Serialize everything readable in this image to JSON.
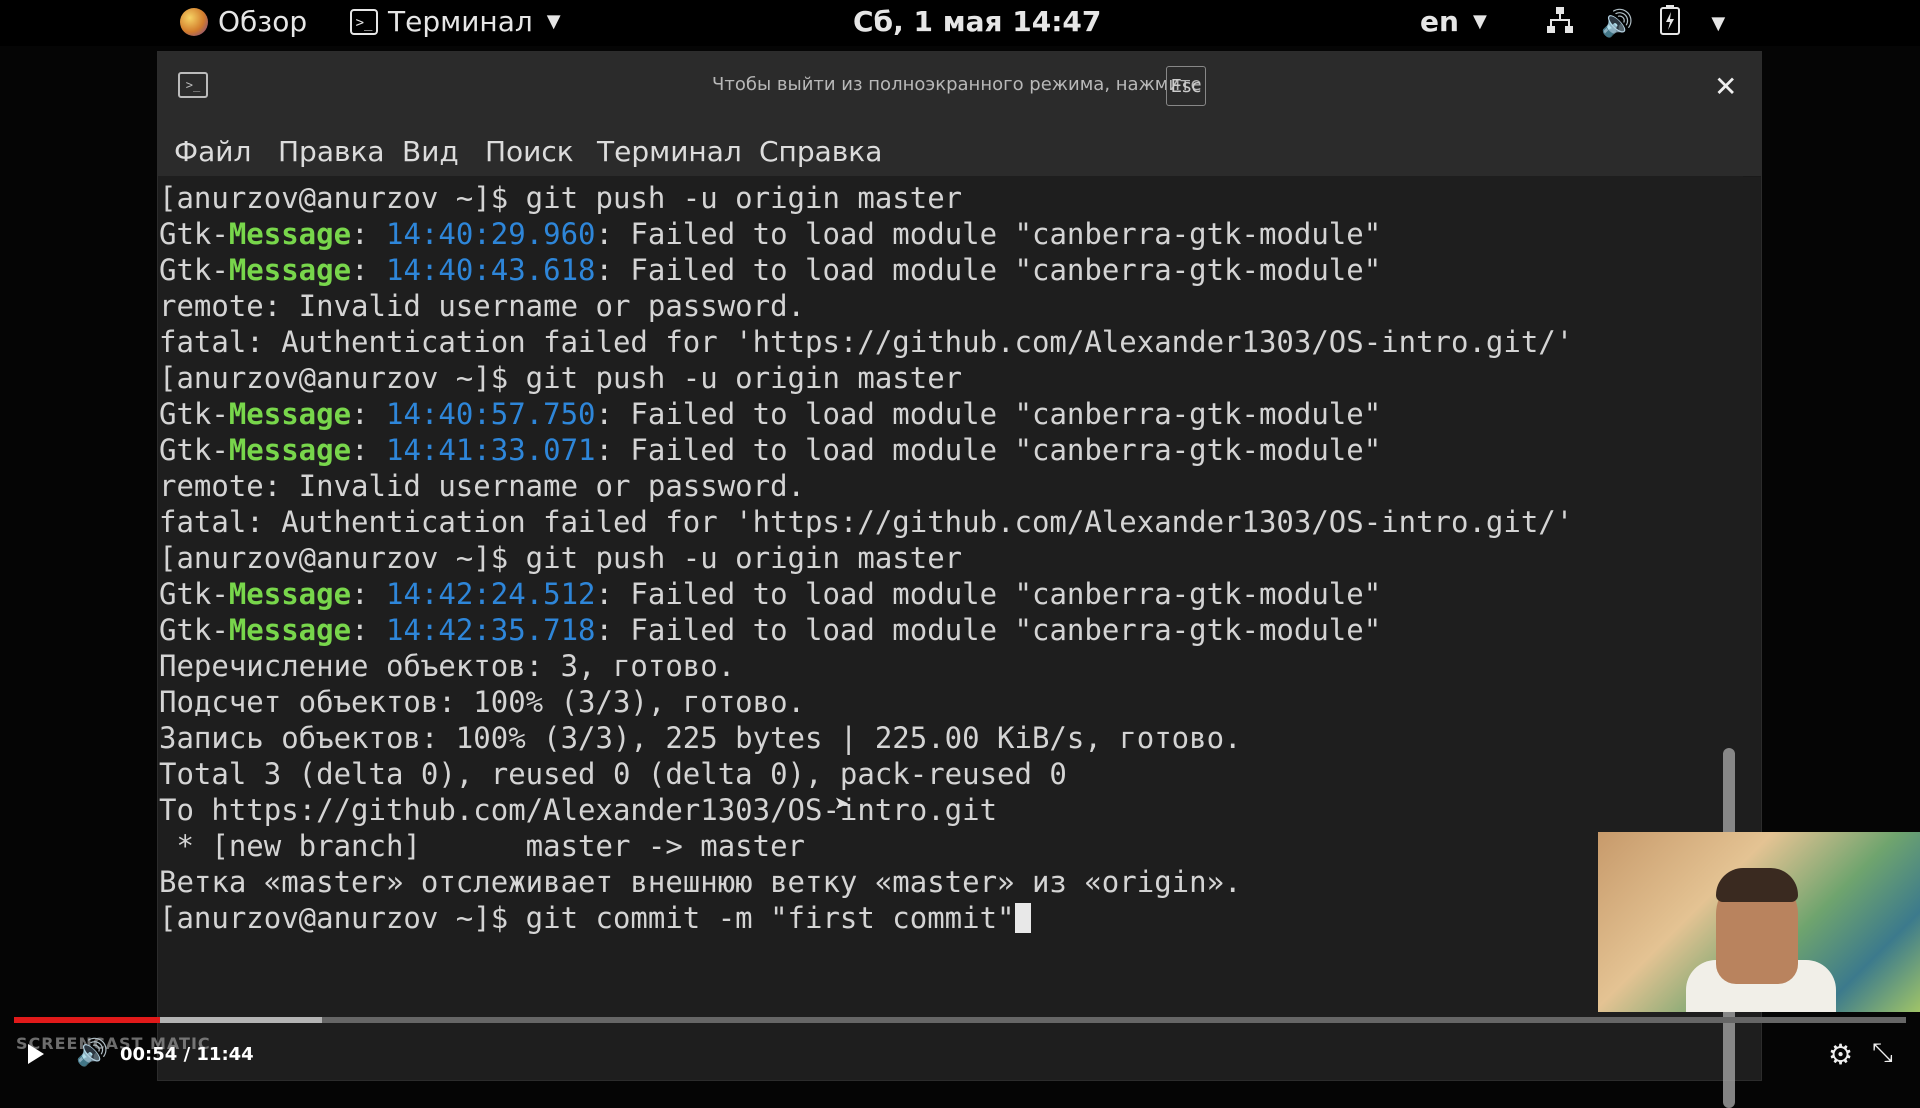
{
  "topbar": {
    "overview_label": "Обзор",
    "app_label": "Терминал",
    "clock": "Сб, 1 мая  14:47",
    "lang": "en"
  },
  "window": {
    "fullscreen_hint": "Чтобы выйти из полноэкранного режима, нажмите",
    "esc_label": "Esc",
    "close_glyph": "✕"
  },
  "menu": {
    "file": "Файл",
    "edit": "Правка",
    "view": "Вид",
    "search": "Поиск",
    "terminal": "Терминал",
    "help": "Справка"
  },
  "terminal": {
    "lines": [
      {
        "text": "[anurzov@anurzov ~]$ git push -u origin master"
      },
      {
        "gtk": "Gtk-",
        "msg": "Message",
        "colon": ": ",
        "ts": "14:40:29.960",
        "rest": ": Failed to load module \"canberra-gtk-module\""
      },
      {
        "gtk": "Gtk-",
        "msg": "Message",
        "colon": ": ",
        "ts": "14:40:43.618",
        "rest": ": Failed to load module \"canberra-gtk-module\""
      },
      {
        "text": "remote: Invalid username or password."
      },
      {
        "text": "fatal: Authentication failed for 'https://github.com/Alexander1303/OS-intro.git/'"
      },
      {
        "text": "[anurzov@anurzov ~]$ git push -u origin master"
      },
      {
        "gtk": "Gtk-",
        "msg": "Message",
        "colon": ": ",
        "ts": "14:40:57.750",
        "rest": ": Failed to load module \"canberra-gtk-module\""
      },
      {
        "gtk": "Gtk-",
        "msg": "Message",
        "colon": ": ",
        "ts": "14:41:33.071",
        "rest": ": Failed to load module \"canberra-gtk-module\""
      },
      {
        "text": "remote: Invalid username or password."
      },
      {
        "text": "fatal: Authentication failed for 'https://github.com/Alexander1303/OS-intro.git/'"
      },
      {
        "text": "[anurzov@anurzov ~]$ git push -u origin master"
      },
      {
        "gtk": "Gtk-",
        "msg": "Message",
        "colon": ": ",
        "ts": "14:42:24.512",
        "rest": ": Failed to load module \"canberra-gtk-module\""
      },
      {
        "gtk": "Gtk-",
        "msg": "Message",
        "colon": ": ",
        "ts": "14:42:35.718",
        "rest": ": Failed to load module \"canberra-gtk-module\""
      },
      {
        "text": "Перечисление объектов: 3, готово."
      },
      {
        "text": "Подсчет объектов: 100% (3/3), готово."
      },
      {
        "text": "Запись объектов: 100% (3/3), 225 bytes | 225.00 KiB/s, готово."
      },
      {
        "text": "Total 3 (delta 0), reused 0 (delta 0), pack-reused 0"
      },
      {
        "text": "To https://github.com/Alexander1303/OS-intro.git"
      },
      {
        "text": " * [new branch]      master -> master"
      },
      {
        "text": "Ветка «master» отслеживает внешнюю ветку «master» из «origin»."
      },
      {
        "text": "[anurzov@anurzov ~]$ git commit -m \"first commit\"",
        "cursor": true
      }
    ]
  },
  "player": {
    "time": "00:54 / 11:44",
    "played_fraction": 0.077,
    "buffered_fraction": 0.163,
    "watermark": "SCREENCAST  MATIC"
  },
  "colors": {
    "gtk_message": "#78d64b",
    "timestamp": "#2e86d9",
    "progress_played": "#e11a1a"
  },
  "icons": [
    "terminal-icon",
    "network-icon",
    "volume-icon",
    "battery-icon",
    "play-icon",
    "gear-icon",
    "fullscreen-icon",
    "close-icon"
  ]
}
